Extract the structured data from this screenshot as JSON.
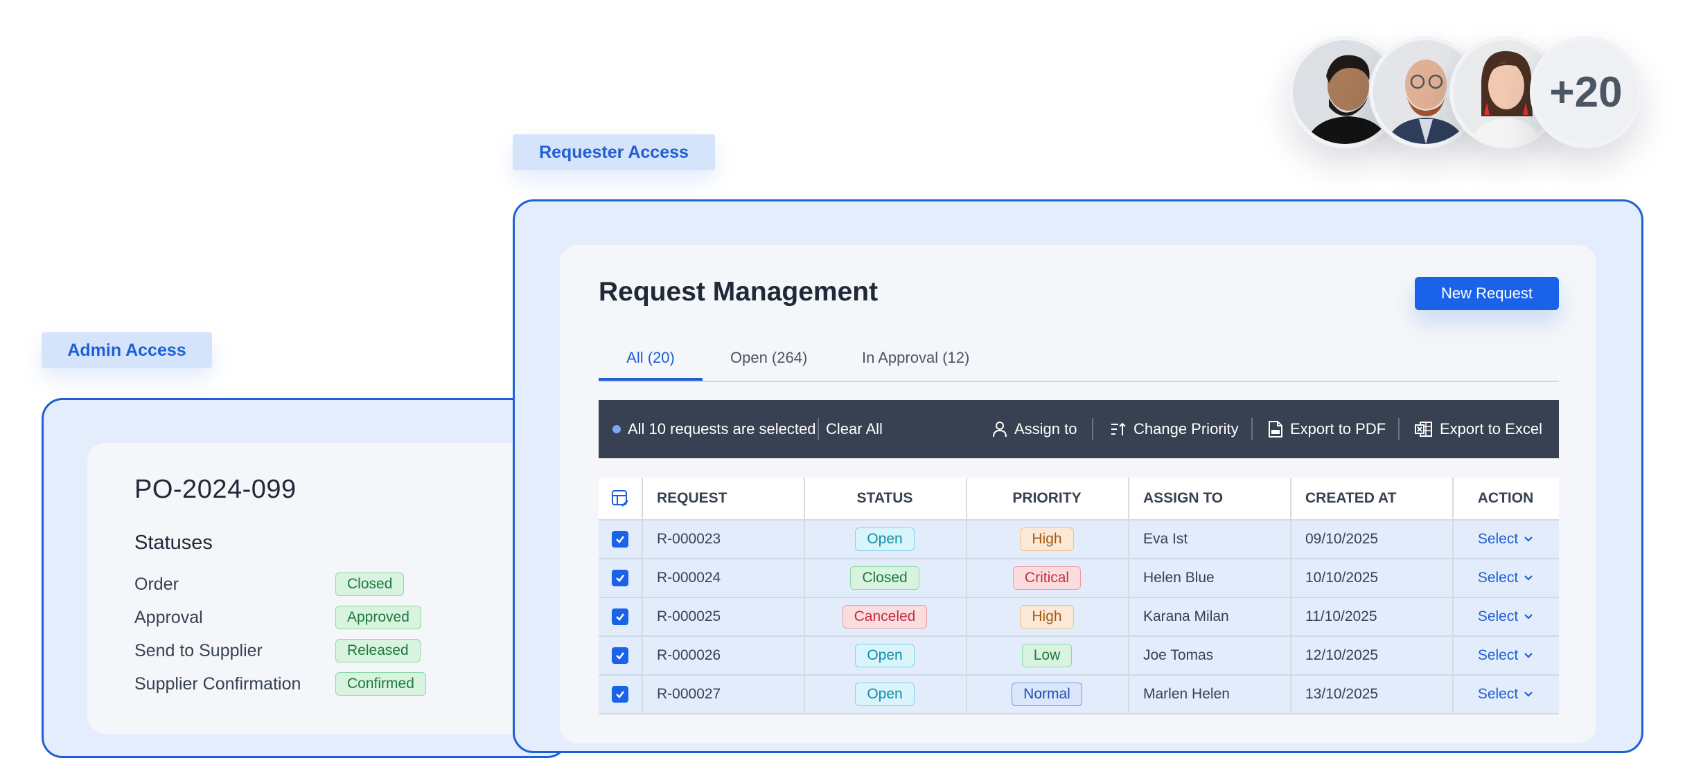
{
  "labels": {
    "requester": "Requester Access",
    "admin": "Admin Access"
  },
  "avatars": {
    "more_count": "+20"
  },
  "admin": {
    "po_number": "PO-2024-099",
    "statuses_title": "Statuses",
    "statuses": [
      {
        "name": "Order",
        "value": "Closed"
      },
      {
        "name": "Approval",
        "value": "Approved"
      },
      {
        "name": "Send to Supplier",
        "value": "Released"
      },
      {
        "name": "Supplier Confirmation",
        "value": "Confirmed"
      }
    ]
  },
  "requester": {
    "title": "Request Management",
    "new_request": "New Request",
    "tabs": [
      {
        "label": "All (20)",
        "active": true
      },
      {
        "label": "Open (264)",
        "active": false
      },
      {
        "label": "In Approval (12)",
        "active": false
      }
    ],
    "bulkbar": {
      "selected_text": "All 10 requests are selected",
      "clear_all": "Clear All",
      "assign_to": "Assign to",
      "change_priority": "Change Priority",
      "export_pdf": "Export to PDF",
      "export_excel": "Export to Excel"
    },
    "table": {
      "headers": [
        "REQUEST",
        "STATUS",
        "PRIORITY",
        "ASSIGN TO",
        "CREATED AT",
        "ACTION"
      ],
      "rows": [
        {
          "request": "R-000023",
          "status": "Open",
          "priority": "High",
          "assignee": "Eva Ist",
          "created": "09/10/2025",
          "action": "Select"
        },
        {
          "request": "R-000024",
          "status": "Closed",
          "priority": "Critical",
          "assignee": "Helen Blue",
          "created": "10/10/2025",
          "action": "Select"
        },
        {
          "request": "R-000025",
          "status": "Canceled",
          "priority": "High",
          "assignee": "Karana Milan",
          "created": "11/10/2025",
          "action": "Select"
        },
        {
          "request": "R-000026",
          "status": "Open",
          "priority": "Low",
          "assignee": "Joe Tomas",
          "created": "12/10/2025",
          "action": "Select"
        },
        {
          "request": "R-000027",
          "status": "Open",
          "priority": "Normal",
          "assignee": "Marlen Helen",
          "created": "13/10/2025",
          "action": "Select"
        }
      ]
    }
  },
  "colors": {
    "accent": "#1a63e8",
    "frame": "#1d5fd6",
    "bulkbar": "#374151"
  }
}
